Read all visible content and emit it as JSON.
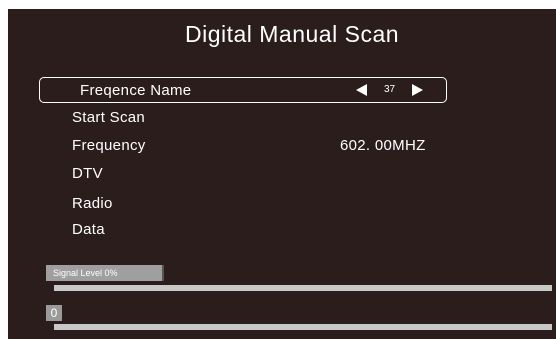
{
  "title": "Digital Manual Scan",
  "menu": {
    "selected": {
      "label": "Freqence Name",
      "value": "37",
      "left_arrow_icon": "triangle-left-icon",
      "right_arrow_icon": "triangle-right-icon"
    },
    "start_scan": "Start Scan",
    "frequency_label": "Frequency",
    "frequency_value": "602. 00MHZ",
    "dtv": "DTV",
    "radio": "Radio",
    "data": "Data"
  },
  "signal": {
    "label": "Signal  Level 0%",
    "level_percent": 0
  },
  "progress": {
    "label": "0",
    "percent": 0
  },
  "colors": {
    "background": "#2b1d1b",
    "text": "#ffffff",
    "bar": "#c8c8c8",
    "label_box": "#9f9f9f"
  }
}
